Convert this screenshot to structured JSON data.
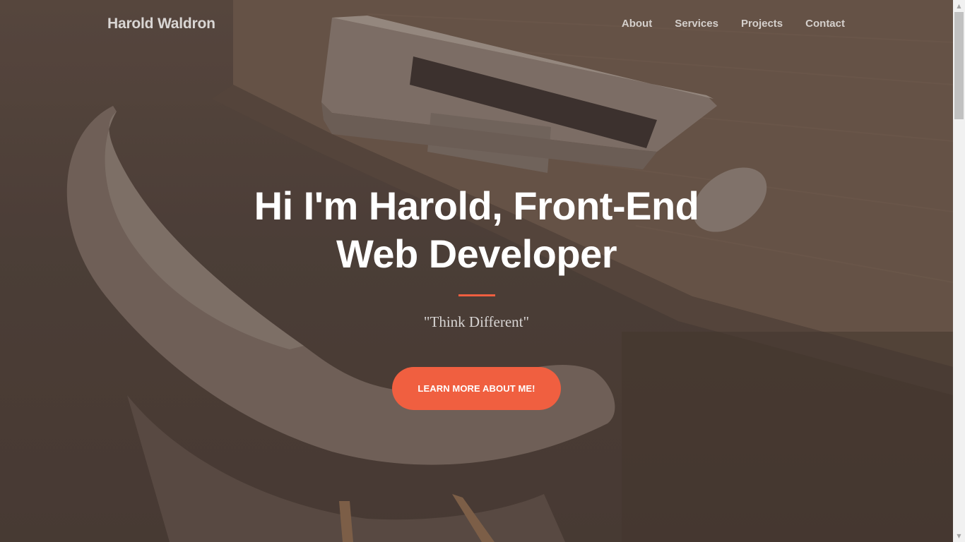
{
  "navbar": {
    "brand": "Harold Waldron",
    "links": [
      "About",
      "Services",
      "Projects",
      "Contact"
    ]
  },
  "hero": {
    "title_line1": "Hi I'm Harold, Front-End",
    "title_line2": "Web Developer",
    "tagline": "\"Think Different\"",
    "cta_label": "LEARN MORE ABOUT ME!"
  },
  "colors": {
    "accent": "#f05f40",
    "overlay": "#4b3e37"
  },
  "icons": {
    "scroll_up": "chevron-up-icon",
    "scroll_down": "chevron-down-icon"
  }
}
